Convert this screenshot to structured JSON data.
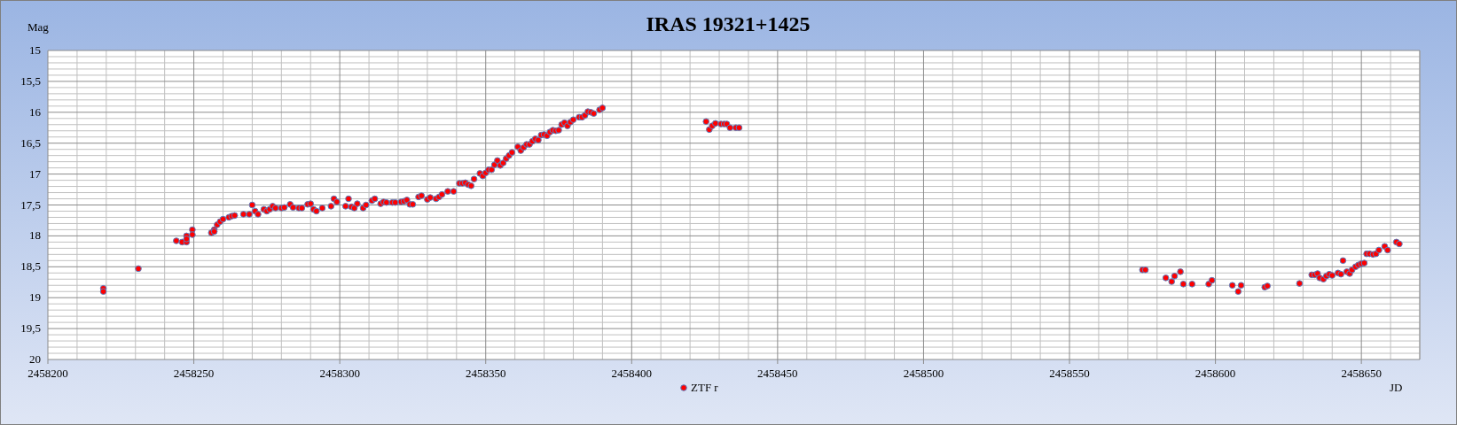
{
  "chart": {
    "chart_data": {
      "type": "scatter",
      "grid": true,
      "title": "IRAS 19321+1425",
      "xlabel": "JD",
      "ylabel": "Mag",
      "x": [
        2458219,
        2458219,
        2458231,
        2458244,
        2458246,
        2458247.5,
        2458247.5,
        2458247.5,
        2458249.5,
        2458249.5,
        2458256,
        2458257,
        2458257,
        2458258,
        2458259,
        2458260,
        2458262,
        2458263,
        2458264,
        2458267,
        2458269,
        2458270,
        2458271,
        2458272,
        2458274,
        2458275,
        2458276,
        2458277,
        2458278,
        2458280,
        2458281,
        2458283,
        2458284,
        2458286,
        2458287,
        2458289,
        2458290,
        2458291,
        2458292,
        2458294,
        2458297,
        2458298,
        2458299,
        2458302,
        2458303,
        2458304,
        2458305,
        2458306,
        2458308,
        2458309,
        2458311,
        2458312,
        2458314,
        2458315,
        2458316,
        2458318,
        2458319,
        2458321,
        2458322,
        2458323,
        2458324,
        2458325,
        2458327,
        2458328,
        2458330,
        2458331,
        2458333,
        2458334,
        2458335,
        2458337,
        2458339,
        2458341,
        2458342,
        2458343,
        2458344,
        2458345,
        2458346,
        2458348,
        2458349,
        2458350,
        2458351,
        2458352,
        2458353,
        2458354,
        2458355,
        2458356,
        2458357,
        2458358,
        2458359,
        2458361,
        2458362,
        2458363,
        2458364,
        2458365,
        2458366,
        2458367,
        2458368,
        2458369,
        2458370,
        2458371,
        2458372,
        2458373,
        2458374,
        2458375,
        2458376,
        2458377,
        2458378,
        2458379,
        2458380,
        2458382,
        2458383,
        2458384,
        2458385,
        2458386,
        2458387,
        2458389,
        2458390,
        2458425.5,
        2458426.6,
        2458427.6,
        2458428.7,
        2458430.6,
        2458431.7,
        2458432.6,
        2458433.7,
        2458435.7,
        2458436.8,
        2458575,
        2458576,
        2458583,
        2458585,
        2458586,
        2458588,
        2458589,
        2458592,
        2458597.7,
        2458598.8,
        2458605.8,
        2458607.8,
        2458608.8,
        2458616.9,
        2458617.8,
        2458628.8,
        2458633,
        2458634,
        2458635,
        2458635.7,
        2458637,
        2458638,
        2458639,
        2458640,
        2458642,
        2458643,
        2458643.7,
        2458645,
        2458646,
        2458646.8,
        2458648,
        2458649,
        2458650,
        2458651,
        2458651.8,
        2458652.8,
        2458654,
        2458655,
        2458656,
        2458658,
        2458659,
        2458662,
        2458663
      ],
      "series": [
        {
          "name": "ZTF r",
          "color": "#ff0000",
          "values": [
            18.85,
            18.9,
            18.53,
            18.08,
            18.1,
            18.1,
            18.0,
            18.05,
            17.9,
            17.98,
            17.95,
            17.9,
            17.93,
            17.82,
            17.77,
            17.73,
            17.7,
            17.68,
            17.67,
            17.65,
            17.65,
            17.5,
            17.6,
            17.65,
            17.57,
            17.6,
            17.57,
            17.52,
            17.55,
            17.55,
            17.54,
            17.49,
            17.54,
            17.55,
            17.55,
            17.49,
            17.48,
            17.57,
            17.6,
            17.55,
            17.52,
            17.4,
            17.45,
            17.52,
            17.4,
            17.53,
            17.55,
            17.48,
            17.55,
            17.5,
            17.43,
            17.4,
            17.48,
            17.45,
            17.46,
            17.46,
            17.46,
            17.45,
            17.44,
            17.42,
            17.49,
            17.49,
            17.37,
            17.35,
            17.41,
            17.38,
            17.4,
            17.37,
            17.33,
            17.28,
            17.28,
            17.15,
            17.15,
            17.14,
            17.17,
            17.19,
            17.08,
            16.99,
            17.03,
            16.98,
            16.93,
            16.93,
            16.85,
            16.78,
            16.86,
            16.82,
            16.75,
            16.7,
            16.65,
            16.56,
            16.62,
            16.57,
            16.52,
            16.52,
            16.47,
            16.43,
            16.45,
            16.37,
            16.36,
            16.38,
            16.32,
            16.29,
            16.3,
            16.29,
            16.2,
            16.17,
            16.22,
            16.16,
            16.12,
            16.08,
            16.08,
            16.05,
            15.99,
            16.0,
            16.02,
            15.96,
            15.93,
            16.15,
            16.28,
            16.22,
            16.18,
            16.19,
            16.19,
            16.19,
            16.25,
            16.25,
            16.25,
            18.55,
            18.55,
            18.68,
            18.74,
            18.65,
            18.58,
            18.78,
            18.78,
            18.78,
            18.72,
            18.8,
            18.9,
            18.8,
            18.83,
            18.81,
            18.77,
            18.63,
            18.63,
            18.61,
            18.68,
            18.7,
            18.65,
            18.62,
            18.64,
            18.6,
            18.62,
            18.4,
            18.58,
            18.61,
            18.55,
            18.5,
            18.47,
            18.45,
            18.44,
            18.29,
            18.29,
            18.3,
            18.29,
            18.23,
            18.17,
            18.23,
            18.1,
            18.13
          ]
        }
      ],
      "xlim": [
        2458200,
        2458670
      ],
      "ylim": [
        20,
        15
      ],
      "xticks": [
        2458200,
        2458250,
        2458300,
        2458350,
        2458400,
        2458450,
        2458500,
        2458550,
        2458600,
        2458650
      ],
      "yticks": [
        {
          "value": 15,
          "label": "15"
        },
        {
          "value": 15.5,
          "label": "15,5"
        },
        {
          "value": 16,
          "label": "16"
        },
        {
          "value": 16.5,
          "label": "16,5"
        },
        {
          "value": 17,
          "label": "17"
        },
        {
          "value": 17.5,
          "label": "17,5"
        },
        {
          "value": 18,
          "label": "18"
        },
        {
          "value": 18.5,
          "label": "18,5"
        },
        {
          "value": 19,
          "label": "19"
        },
        {
          "value": 19.5,
          "label": "19,5"
        },
        {
          "value": 20,
          "label": "20"
        }
      ]
    }
  }
}
